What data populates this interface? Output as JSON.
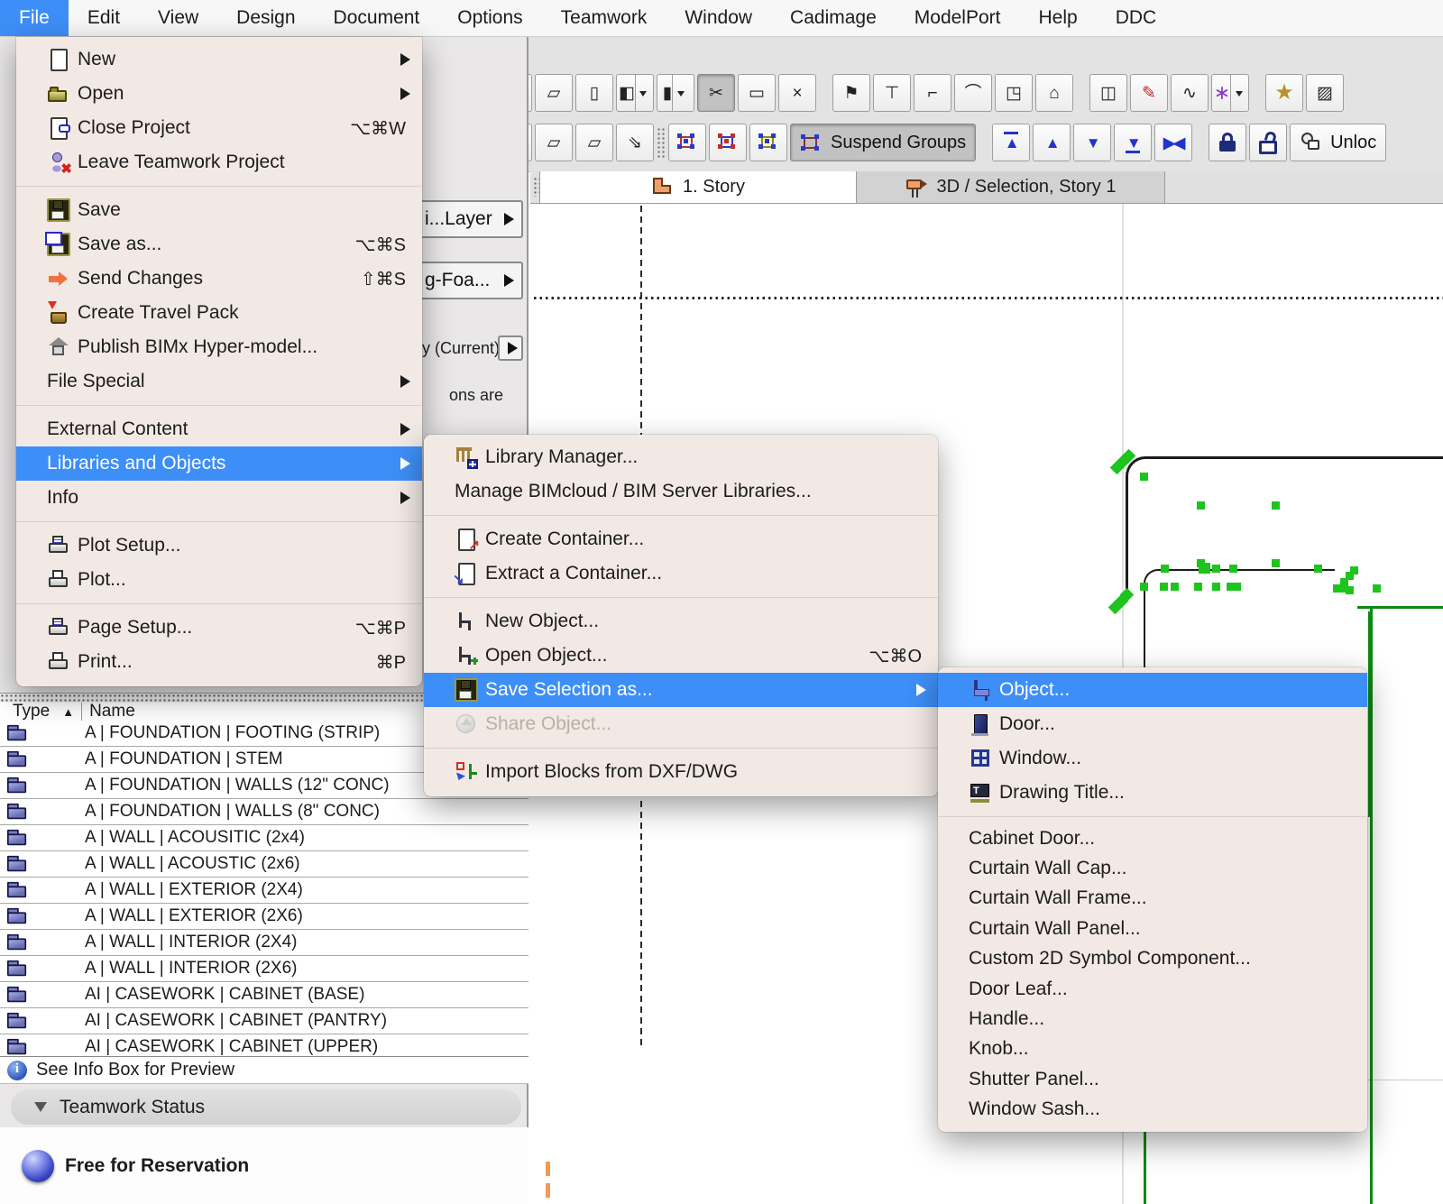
{
  "menubar": {
    "items": [
      {
        "name": "menu-file",
        "label": "File",
        "cls": "active"
      },
      {
        "name": "menu-edit",
        "label": "Edit"
      },
      {
        "name": "menu-view",
        "label": "View"
      },
      {
        "name": "menu-design",
        "label": "Design"
      },
      {
        "name": "menu-document",
        "label": "Document"
      },
      {
        "name": "menu-options",
        "label": "Options"
      },
      {
        "name": "menu-teamwork",
        "label": "Teamwork"
      },
      {
        "name": "menu-window",
        "label": "Window"
      },
      {
        "name": "menu-cadimage",
        "label": "Cadimage"
      },
      {
        "name": "menu-modelport",
        "label": "ModelPort"
      },
      {
        "name": "menu-help",
        "label": "Help"
      },
      {
        "name": "menu-ddc",
        "label": "DDC"
      }
    ]
  },
  "toolbar": {
    "row1": [
      {
        "name": "dashed-line-tool-icon",
        "glyph": "⋯",
        "dd": true
      },
      {
        "name": "cursor-snap-tool-icon",
        "glyph": "⌖",
        "dd": true,
        "cls": "pressed"
      },
      {
        "name": "dot-grid-tool-icon",
        "glyph": "∷",
        "dd": true
      },
      {
        "name": "slab-plane-tool-icon",
        "glyph": "▱"
      },
      {
        "name": "wall-plane-tool-icon",
        "glyph": "▯"
      },
      {
        "name": "overlap-layers-tool-icon",
        "glyph": "◧",
        "dd": true
      },
      {
        "name": "column-tool-icon",
        "glyph": "▮",
        "dd": true
      },
      {
        "name": "trim-tool-icon",
        "glyph": "✂",
        "cls": "pressed"
      },
      {
        "name": "measure-tool-icon",
        "glyph": "▭"
      },
      {
        "name": "stretch-tool-icon",
        "glyph": "×"
      },
      {
        "cls": "gap"
      },
      {
        "name": "flag-tool-icon",
        "glyph": "⚑"
      },
      {
        "name": "gravity-tool-icon",
        "glyph": "⊤"
      },
      {
        "name": "corner-tool-icon",
        "glyph": "⌐"
      },
      {
        "name": "arc-tool-icon",
        "glyph": "⌒"
      },
      {
        "name": "box-corner-tool-icon",
        "glyph": "◳"
      },
      {
        "name": "home-story-tool-icon",
        "glyph": "⌂"
      },
      {
        "cls": "gap"
      },
      {
        "name": "frame-tool-icon",
        "glyph": "◫"
      },
      {
        "name": "red-pen-tool-icon",
        "glyph": "✎",
        "cls": "red-ic"
      },
      {
        "name": "freehand-tool-icon",
        "glyph": "∿"
      },
      {
        "name": "magic-wand-tool-icon",
        "glyph": "∗",
        "cls": "purple-ic",
        "dd": true
      },
      {
        "cls": "gap"
      },
      {
        "name": "favorites-star-icon",
        "glyph": "★",
        "cls": "gold-ic"
      },
      {
        "name": "extra-tool-icon",
        "glyph": "▨"
      }
    ],
    "row2": [
      {
        "name": "wall-join-tool-icon",
        "glyph": "≡",
        "dd": true
      },
      {
        "name": "add-node-tool-icon",
        "glyph": "+",
        "dd": true
      },
      {
        "name": "pen-tool-icon",
        "glyph": "✎",
        "dd": true
      },
      {
        "name": "plane-a-tool-icon",
        "glyph": "▱"
      },
      {
        "name": "plane-b-tool-icon",
        "glyph": "▱"
      },
      {
        "name": "plane-arrow-tool-icon",
        "glyph": "⇘"
      },
      {
        "name": "toolbar-drag-handle",
        "cls": "handle"
      },
      {
        "name": "group-icon",
        "icon": "grp-rb-icon"
      },
      {
        "name": "ungroup-icon",
        "icon": "grp-br-icon"
      },
      {
        "name": "autogroup-icon",
        "icon": "grp-y-icon"
      },
      {
        "name": "suspend-groups-button",
        "icon": "suspend-groups-icon",
        "label": "Suspend Groups",
        "cls": "pressed wide"
      },
      {
        "cls": "gap"
      },
      {
        "name": "bring-to-front-button",
        "glyph": "▲",
        "cls": "blue-ic bar-top"
      },
      {
        "name": "bring-forward-button",
        "glyph": "▲",
        "cls": "blue-ic"
      },
      {
        "name": "send-backward-button",
        "glyph": "▼",
        "cls": "blue-ic"
      },
      {
        "name": "send-to-back-button",
        "glyph": "▼",
        "cls": "blue-ic bar-bottom"
      },
      {
        "name": "reset-order-button",
        "glyph": "▶◀",
        "cls": "blue-ic"
      },
      {
        "cls": "gap"
      },
      {
        "name": "lock-button",
        "icon": "lock-icon"
      },
      {
        "name": "unlock-button",
        "icon": "unlock-icon"
      },
      {
        "name": "unlock-elements-button",
        "icon": "person-unlock-icon",
        "label": "Unloc",
        "cls": "wide"
      }
    ]
  },
  "infobox": {
    "layer_button_label": "i...Layer",
    "foa_button_label": "g-Foa...",
    "current_label": "y (Current)",
    "note_fragment": "ons are"
  },
  "tabs": [
    {
      "name": "tab-1-story",
      "label": "1. Story",
      "icon": "floor-plan-icon"
    },
    {
      "name": "tab-3d-selection",
      "label": "3D / Selection, Story 1",
      "icon": "camera-icon"
    }
  ],
  "menus": {
    "file": {
      "groups": [
        [
          {
            "name": "menu-item-new",
            "label": "New",
            "icon": "new-icon",
            "submenu": true
          },
          {
            "name": "menu-item-open",
            "label": "Open",
            "icon": "open-icon",
            "submenu": true
          },
          {
            "name": "menu-item-close-project",
            "label": "Close Project",
            "icon": "close-project-icon",
            "shortcut": "⌥⌘W"
          },
          {
            "name": "menu-item-leave-teamwork",
            "label": "Leave Teamwork Project",
            "icon": "leave-teamwork-icon"
          }
        ],
        [
          {
            "name": "menu-item-save",
            "label": "Save",
            "icon": "save-icon"
          },
          {
            "name": "menu-item-save-as",
            "label": "Save as...",
            "icon": "save-as-icon",
            "shortcut": "⌥⌘S"
          },
          {
            "name": "menu-item-send-changes",
            "label": "Send Changes",
            "icon": "send-changes-icon",
            "shortcut": "⇧⌘S"
          },
          {
            "name": "menu-item-create-travel-pack",
            "label": "Create Travel Pack",
            "icon": "travel-pack-icon"
          },
          {
            "name": "menu-item-publish-bimx",
            "label": "Publish BIMx Hyper-model...",
            "icon": "bimx-icon"
          },
          {
            "name": "menu-item-file-special",
            "label": "File Special",
            "submenu": true
          }
        ],
        [
          {
            "name": "menu-item-external-content",
            "label": "External Content",
            "submenu": true
          },
          {
            "name": "menu-item-libraries-objects",
            "label": "Libraries and Objects",
            "submenu": true,
            "cls": "hl"
          },
          {
            "name": "menu-item-info",
            "label": "Info",
            "submenu": true
          }
        ],
        [
          {
            "name": "menu-item-plot-setup",
            "label": "Plot Setup...",
            "icon": "plot-setup-icon"
          },
          {
            "name": "menu-item-plot",
            "label": "Plot...",
            "icon": "plot-icon"
          }
        ],
        [
          {
            "name": "menu-item-page-setup",
            "label": "Page Setup...",
            "icon": "page-setup-icon",
            "shortcut": "⌥⌘P"
          },
          {
            "name": "menu-item-print",
            "label": "Print...",
            "icon": "print-icon",
            "shortcut": "⌘P"
          }
        ]
      ]
    },
    "libraries_submenu": {
      "groups": [
        [
          {
            "name": "menu-item-library-manager",
            "label": "Library Manager...",
            "icon": "library-manager-icon"
          },
          {
            "name": "menu-item-manage-bimcloud",
            "label": "Manage BIMcloud / BIM Server Libraries..."
          }
        ],
        [
          {
            "name": "menu-item-create-container",
            "label": "Create Container...",
            "icon": "create-container-icon"
          },
          {
            "name": "menu-item-extract-container",
            "label": "Extract a Container...",
            "icon": "extract-container-icon"
          }
        ],
        [
          {
            "name": "menu-item-new-object",
            "label": "New Object...",
            "icon": "new-object-icon"
          },
          {
            "name": "menu-item-open-object",
            "label": "Open Object...",
            "icon": "open-object-icon",
            "shortcut": "⌥⌘O"
          },
          {
            "name": "menu-item-save-selection-as",
            "label": "Save Selection as...",
            "icon": "save-selection-icon",
            "submenu": true,
            "cls": "hl"
          },
          {
            "name": "menu-item-share-object",
            "label": "Share Object...",
            "icon": "share-object-icon",
            "cls": "dis"
          }
        ],
        [
          {
            "name": "menu-item-import-blocks",
            "label": "Import Blocks from DXF/DWG",
            "icon": "import-blocks-icon"
          }
        ]
      ]
    },
    "save_selection_submenu": {
      "groups": [
        [
          {
            "name": "menu-item-object",
            "label": "Object...",
            "icon": "object-icon",
            "cls": "hl"
          },
          {
            "name": "menu-item-door",
            "label": "Door...",
            "icon": "door-icon"
          },
          {
            "name": "menu-item-window",
            "label": "Window...",
            "icon": "window-icon"
          },
          {
            "name": "menu-item-drawing-title",
            "label": "Drawing Title...",
            "icon": "drawing-title-icon"
          }
        ],
        [
          {
            "name": "menu-item-cabinet-door",
            "label": "Cabinet Door..."
          },
          {
            "name": "menu-item-curtain-wall-cap",
            "label": "Curtain Wall Cap..."
          },
          {
            "name": "menu-item-curtain-wall-frame",
            "label": "Curtain Wall Frame..."
          },
          {
            "name": "menu-item-curtain-wall-panel",
            "label": "Curtain Wall Panel..."
          },
          {
            "name": "menu-item-custom-2d-symbol",
            "label": "Custom 2D Symbol Component..."
          },
          {
            "name": "menu-item-door-leaf",
            "label": "Door Leaf..."
          },
          {
            "name": "menu-item-handle",
            "label": "Handle..."
          },
          {
            "name": "menu-item-knob",
            "label": "Knob..."
          },
          {
            "name": "menu-item-shutter-panel",
            "label": "Shutter Panel..."
          },
          {
            "name": "menu-item-window-sash",
            "label": "Window Sash..."
          }
        ]
      ]
    }
  },
  "library_panel": {
    "columns": {
      "type": "Type",
      "name": "Name"
    },
    "rows": [
      {
        "name": "table-row",
        "icon": "folder-icon",
        "label": "A | FOUNDATION | FOOTING (STRIP)"
      },
      {
        "name": "table-row",
        "icon": "folder-icon",
        "label": "A | FOUNDATION | STEM"
      },
      {
        "name": "table-row",
        "icon": "folder-icon",
        "label": "A | FOUNDATION | WALLS (12\" CONC)"
      },
      {
        "name": "table-row",
        "icon": "folder-icon",
        "label": "A | FOUNDATION | WALLS (8\" CONC)"
      },
      {
        "name": "table-row",
        "icon": "folder-icon",
        "label": "A | WALL | ACOUSITIC (2x4)"
      },
      {
        "name": "table-row",
        "icon": "folder-icon",
        "label": "A | WALL | ACOUSTIC (2x6)"
      },
      {
        "name": "table-row",
        "icon": "folder-icon",
        "label": "A | WALL | EXTERIOR (2X4)"
      },
      {
        "name": "table-row",
        "icon": "folder-icon",
        "label": "A | WALL | EXTERIOR (2X6)"
      },
      {
        "name": "table-row",
        "icon": "folder-icon",
        "label": "A | WALL | INTERIOR (2X4)"
      },
      {
        "name": "table-row",
        "icon": "folder-icon",
        "label": "A | WALL | INTERIOR (2X6)"
      },
      {
        "name": "table-row",
        "icon": "folder-icon",
        "label": "AI | CASEWORK | CABINET (BASE)"
      },
      {
        "name": "table-row",
        "icon": "folder-icon",
        "label": "AI | CASEWORK | CABINET (PANTRY)"
      },
      {
        "name": "table-row",
        "icon": "folder-icon",
        "label": "AI | CASEWORK | CABINET (UPPER)"
      },
      {
        "name": "table-row",
        "icon": "folder-icon",
        "label": ""
      }
    ],
    "info_note": "See Info Box for Preview",
    "teamwork_status_label": "Teamwork Status",
    "reservation_status": "Free for Reservation"
  },
  "colors": {
    "accent": "#3e8ef7",
    "menu_bg": "#f2e9e5",
    "drawing_green": "#0c8a10",
    "selection_green": "#1dc41d",
    "tab_orange": "#efa06a"
  }
}
